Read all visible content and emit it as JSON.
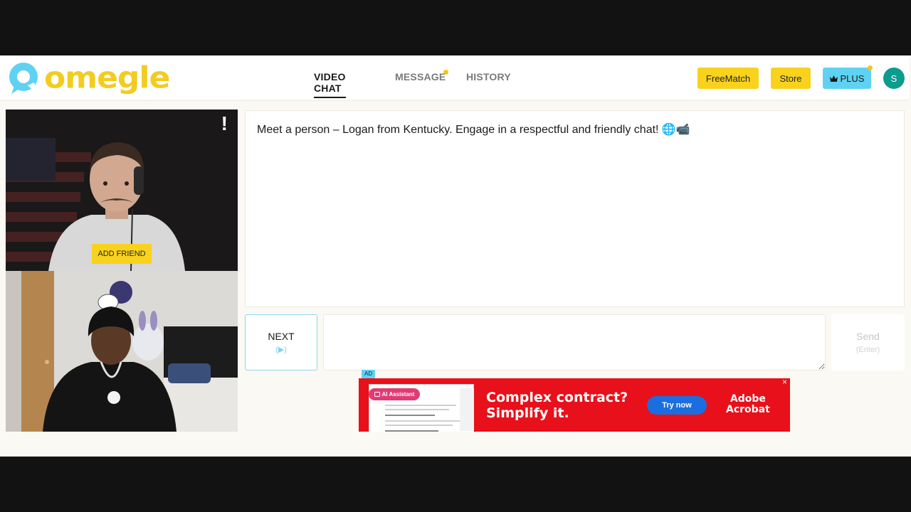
{
  "header": {
    "logo_text": "omegle",
    "nav": {
      "video_chat": "VIDEO CHAT",
      "message": "MESSAGE",
      "history": "HISTORY"
    },
    "buttons": {
      "freematch": "FreeMatch",
      "store": "Store",
      "plus": "PLUS"
    },
    "avatar_initial": "S",
    "colors": {
      "brand_yellow": "#f8d21d",
      "plus_blue": "#5fd2f2",
      "avatar_teal": "#0b9c8f"
    }
  },
  "video": {
    "report_icon": "!",
    "add_friend": "ADD FRIEND"
  },
  "chat": {
    "message": "Meet a person – Logan from Kentucky. Engage in a respectful and friendly chat! 🌐📹"
  },
  "controls": {
    "next_label": "NEXT",
    "next_hint": "(▶)",
    "send_label": "Send",
    "send_hint": "(Enter)"
  },
  "ad": {
    "badge": "AD",
    "ai_label": "AI Assistant",
    "headline_1": "Complex contract?",
    "headline_2": "Simplify it.",
    "cta": "Try now",
    "brand_1": "Adobe",
    "brand_2": "Acrobat",
    "close": "×"
  }
}
